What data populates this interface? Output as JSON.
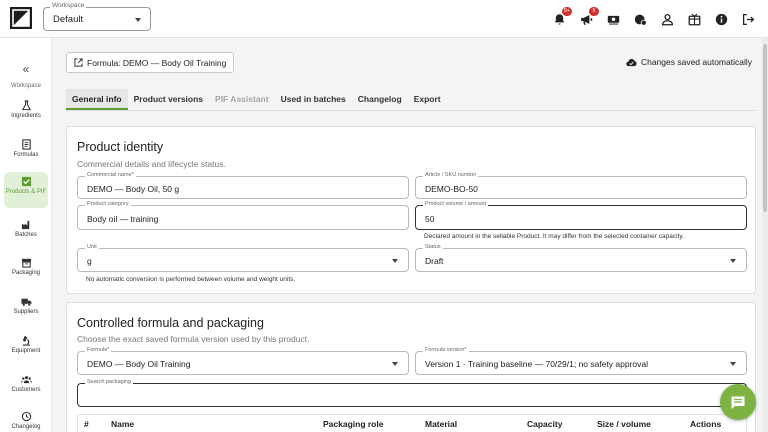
{
  "topbar": {
    "workspace_legend": "Workspace",
    "workspace_value": "Default",
    "notifications_badge": "9+",
    "announcements_badge": "5"
  },
  "sidebar": {
    "heading": "Workspace",
    "items": [
      {
        "label": "Ingredients",
        "icon": "flask-icon"
      },
      {
        "label": "Formulas",
        "icon": "document-icon"
      },
      {
        "label": "Products & PIF",
        "icon": "checkbox-icon"
      },
      {
        "label": "Batches",
        "icon": "factory-icon"
      },
      {
        "label": "Packaging",
        "icon": "box-icon"
      },
      {
        "label": "Suppliers",
        "icon": "truck-icon"
      },
      {
        "label": "Equipment",
        "icon": "microscope-icon"
      },
      {
        "label": "Customers",
        "icon": "people-icon"
      },
      {
        "label": "Changelog",
        "icon": "history-icon"
      }
    ]
  },
  "header": {
    "formula_chip": "Formula: DEMO — Body Oil Training",
    "saved_status": "Changes saved automatically"
  },
  "tabs": [
    {
      "label": "General info",
      "state": "active"
    },
    {
      "label": "Product versions",
      "state": "normal"
    },
    {
      "label": "PIF Assistant",
      "state": "disabled"
    },
    {
      "label": "Used in batches",
      "state": "normal"
    },
    {
      "label": "Changelog",
      "state": "normal"
    },
    {
      "label": "Export",
      "state": "normal"
    }
  ],
  "product_identity": {
    "title": "Product identity",
    "subtitle": "Commercial details and lifecycle status.",
    "commercial_name": {
      "label": "Commercial name*",
      "value": "DEMO — Body Oil, 50 g"
    },
    "sku": {
      "label": "Article / SKU number",
      "value": "DEMO-BO-50"
    },
    "category": {
      "label": "Product category",
      "value": "Body oil — training"
    },
    "volume": {
      "label": "Product volume / amount",
      "value": "50",
      "help": "Declared amount in the sellable Product. It may differ from the selected container capacity."
    },
    "unit": {
      "label": "Unit",
      "value": "g",
      "help": "No automatic conversion is performed between volume and weight units."
    },
    "status": {
      "label": "Status",
      "value": "Draft"
    }
  },
  "formula_packaging": {
    "title": "Controlled formula and packaging",
    "subtitle": "Choose the exact saved formula version used by this product.",
    "formula": {
      "label": "Formula*",
      "value": "DEMO — Body Oil Training"
    },
    "formula_version": {
      "label": "Formula version*",
      "value": "Version 1 · Training baseline — 70/29/1; no safety approval"
    },
    "search": {
      "label": "Search packaging",
      "value": ""
    },
    "table_headers": [
      "#",
      "Name",
      "Packaging role",
      "Material",
      "Capacity",
      "Size / volume",
      "Actions"
    ]
  },
  "colors": {
    "accent": "#5d9c2f",
    "fab": "#7cb342",
    "badge": "#d32f2f"
  }
}
